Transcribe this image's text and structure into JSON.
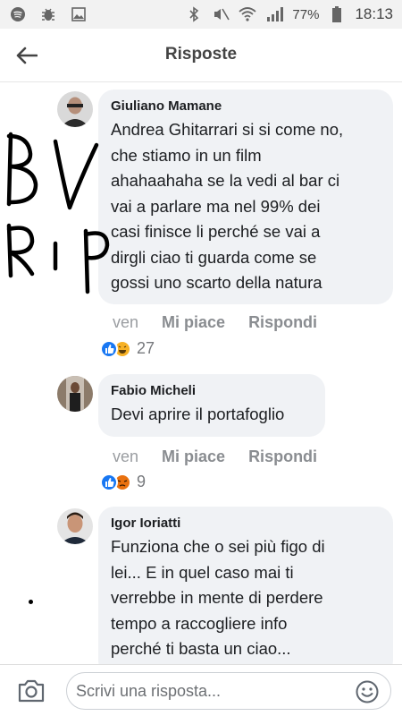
{
  "status_bar": {
    "battery": "77%",
    "time": "18:13"
  },
  "header": {
    "title": "Risposte"
  },
  "handwriting": {
    "line1": "BV",
    "line2": "RIP"
  },
  "comments": [
    {
      "author": "Giuliano Mamane",
      "lines": [
        "Andrea Ghitarrari si si come no,",
        "che stiamo in un film",
        "ahahaahaha se la vedi al bar ci",
        "vai a parlare ma nel 99% dei",
        "casi finisce li perché se vai a",
        "dirgli ciao ti guarda come se",
        "gossi uno scarto della natura"
      ],
      "time": "ven",
      "like": "Mi piace",
      "reply": "Rispondi",
      "reactions": [
        "like",
        "haha"
      ],
      "count": "27"
    },
    {
      "author": "Fabio Micheli",
      "lines": [
        "Devi aprire il portafoglio"
      ],
      "time": "ven",
      "like": "Mi piace",
      "reply": "Rispondi",
      "reactions": [
        "like",
        "angry"
      ],
      "count": "9"
    },
    {
      "author": "Igor Ioriatti",
      "lines": [
        "Funziona che o sei più figo di",
        "lei... E in quel caso mai ti",
        "verrebbe in mente di perdere",
        "tempo a raccogliere info",
        "perché ti basta un ciao..."
      ]
    }
  ],
  "composer": {
    "placeholder": "Scrivi una risposta..."
  },
  "colors": {
    "like_blue": "#1877f2",
    "haha_yellow": "#f7b125",
    "angry_orange": "#e9710f",
    "bubble_gray": "#f0f2f5"
  }
}
